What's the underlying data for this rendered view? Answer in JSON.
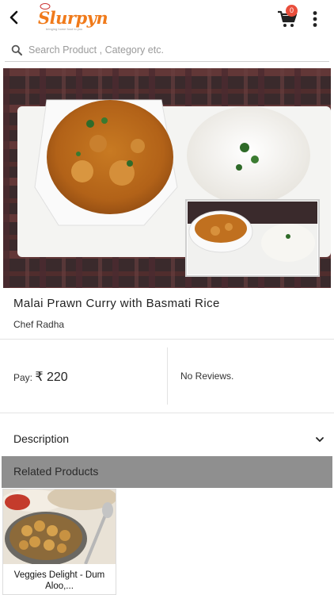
{
  "header": {
    "brand": "Slurpyn",
    "brand_tagline": "bringing home food to you",
    "cart_count": "0",
    "icons": [
      "back-arrow-icon",
      "cart-icon",
      "more-vertical-icon"
    ]
  },
  "search": {
    "placeholder": "Search Product , Category etc."
  },
  "product": {
    "title": "Malai Prawn Curry with Basmati Rice",
    "chef": "Chef Radha",
    "pay_label": "Pay:",
    "price": "₹ 220",
    "reviews": "No Reviews."
  },
  "description": {
    "label": "Description"
  },
  "related": {
    "label": "Related Products",
    "items": [
      {
        "title": "Veggies Delight - Dum Aloo,..."
      }
    ]
  },
  "colors": {
    "brand": "#f07a1a",
    "badge": "#e94e3c",
    "related_bar": "#8f8f8f"
  }
}
